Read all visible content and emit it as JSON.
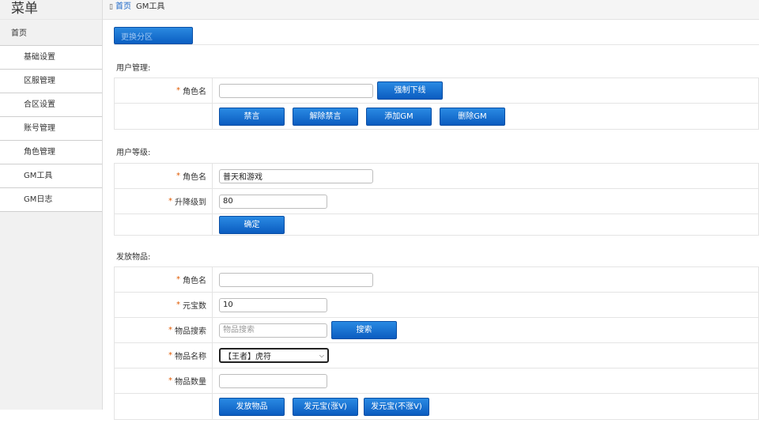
{
  "sidebar": {
    "title": "菜单",
    "home": "首页",
    "items": [
      "基础设置",
      "区服管理",
      "合区设置",
      "账号管理",
      "角色管理",
      "GM工具",
      "GM日志"
    ]
  },
  "breadcrumb": {
    "home_icon": "▯",
    "home": "首页",
    "current": "GM工具"
  },
  "zone_button": "更换分区",
  "user_mgmt": {
    "title": "用户管理:",
    "role_label": "角色名",
    "role_value": "",
    "force_offline": "强制下线",
    "mute": "禁言",
    "unmute": "解除禁言",
    "add_gm": "添加GM",
    "delete_gm": "删除GM"
  },
  "user_level": {
    "title": "用户等级:",
    "role_label": "角色名",
    "role_value": "普天和游戏",
    "level_label": "升降级到",
    "level_value": "80",
    "confirm": "确定"
  },
  "items": {
    "title": "发放物品:",
    "role_label": "角色名",
    "role_value": "",
    "gold_label": "元宝数",
    "gold_value": "10",
    "search_label": "物品搜索",
    "search_placeholder": "物品搜索",
    "search_button": "搜索",
    "name_label": "物品名称",
    "name_selected": "【王者】虎符",
    "qty_label": "物品数量",
    "qty_value": "",
    "send_items": "发放物品",
    "send_gold_vip": "发元宝(涨V)",
    "send_gold_novip": "发元宝(不涨V)"
  },
  "required_mark": "*",
  "colors": {
    "accent": "#0b5fc2",
    "required": "#e05a00",
    "link": "#1a66c8"
  }
}
